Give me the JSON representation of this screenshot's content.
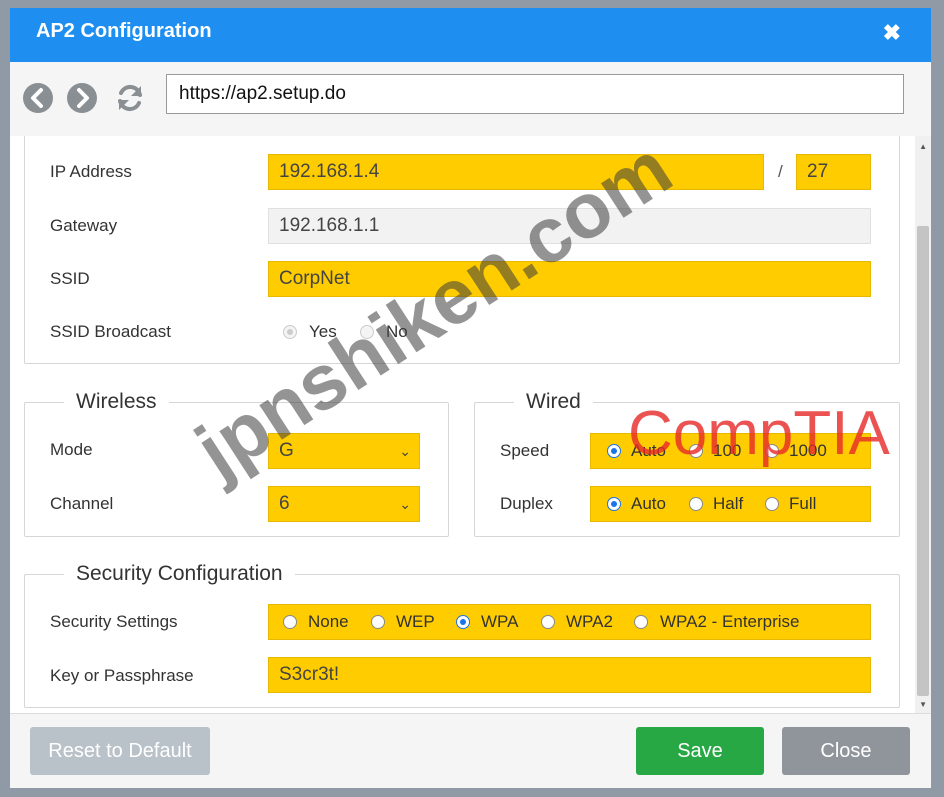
{
  "window": {
    "title": "AP2 Configuration"
  },
  "nav": {
    "url": "https://ap2.setup.do"
  },
  "network": {
    "ip_label": "IP Address",
    "ip_value": "192.168.1.4",
    "mask_sep": "/",
    "mask_value": "27",
    "gateway_label": "Gateway",
    "gateway_value": "192.168.1.1",
    "ssid_label": "SSID",
    "ssid_value": "CorpNet",
    "broadcast_label": "SSID Broadcast",
    "broadcast_yes": "Yes",
    "broadcast_no": "No",
    "broadcast_selected": "Yes"
  },
  "wireless": {
    "legend": "Wireless",
    "mode_label": "Mode",
    "mode_value": "G",
    "channel_label": "Channel",
    "channel_value": "6"
  },
  "wired": {
    "legend": "Wired",
    "speed_label": "Speed",
    "speed_options": [
      "Auto",
      "100",
      "1000"
    ],
    "speed_selected": "Auto",
    "duplex_label": "Duplex",
    "duplex_options": [
      "Auto",
      "Half",
      "Full"
    ],
    "duplex_selected": "Auto"
  },
  "security": {
    "legend": "Security Configuration",
    "settings_label": "Security Settings",
    "options": [
      "None",
      "WEP",
      "WPA",
      "WPA2",
      "WPA2 - Enterprise"
    ],
    "selected": "WPA",
    "key_label": "Key or Passphrase",
    "key_value": "S3cr3t!"
  },
  "footer": {
    "reset_label": "Reset to Default",
    "save_label": "Save",
    "close_label": "Close"
  },
  "watermarks": {
    "site": "jpnshiken.com",
    "brand": "CompTIA"
  },
  "colors": {
    "titlebar": "#1e8ff0",
    "field_highlight": "#ffcc00",
    "save": "#28a745"
  }
}
